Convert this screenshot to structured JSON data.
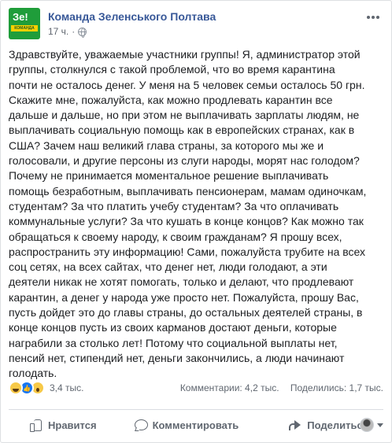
{
  "post": {
    "page_name": "Команда Зеленського Полтава",
    "time": "17 ч.",
    "separator": "·",
    "avatar": {
      "line1": "Зе!",
      "line2": "КОМАНДА"
    },
    "body_lines": [
      "Здравствуйте, уважаемые участники группы! Я, администратор этой",
      "группы, столкнулся с такой проблемой, что во время карантина",
      "почти не осталось денег. У меня на 5 человек семьи осталось 50 грн.",
      "Скажите мне, пожалуйста, как можно продлевать карантин все",
      "дальше и дальше, но при этом не выплачивать зарплаты людям, не",
      "выплачивать социальную помощь как в европейских странах, как в",
      "США? Зачем наш великий глава страны, за которого мы же и",
      "голосовали, и другие персоны из слуги народы, морят нас голодом?",
      "Почему не принимается моментальное решение выплачивать",
      "помощь безработным, выплачивать пенсионерам, мамам одиночкам,",
      "студентам? За что платить учебу студентам? За что оплачивать",
      "коммунальные услуги? За что кушать в конце концов? Как можно так",
      "обращаться к своему народу, к своим гражданам? Я прошу всех,",
      "распространить эту информацию! Сами, пожалуйста трубите на всех",
      "соц сетях, на всех сайтах, что денег нет, люди голодают, а эти",
      "деятели никак не хотят помогать, только и делают, что продлевают",
      "карантин, а денег у народа уже просто нет. Пожалуйста, прошу Вас,",
      "пусть дойдет это до главы страны, до остальных деятелей страны, в",
      "конце концов пусть из своих карманов достают деньги, которые",
      "награбили за столько лет! Потому что социальной выплаты нет,",
      "пенсий нет, стипендий нет, деньги закончились, а люди начинают",
      "голодать."
    ],
    "reactions": {
      "count": "3,4 тыс.",
      "icons": [
        "haha-icon",
        "like-icon",
        "wow-icon"
      ]
    },
    "comments": "Комментарии: 4,2 тыс.",
    "shares": "Поделились: 1,7 тыс."
  },
  "actions": {
    "like": "Нравится",
    "comment": "Комментировать",
    "share": "Поделиться"
  },
  "colors": {
    "page_name": "#385898",
    "meta": "#606770",
    "avatar_bg": "#1f9d3a",
    "avatar_band": "#f7d000",
    "like_blue": "#1877f2"
  }
}
